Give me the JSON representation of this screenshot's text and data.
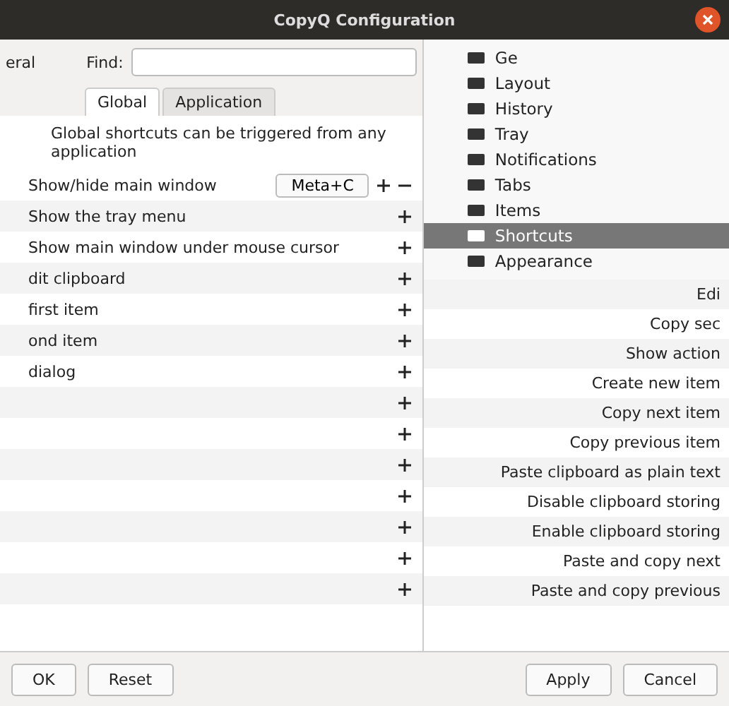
{
  "window": {
    "title": "CopyQ Configuration"
  },
  "find": {
    "label": "Find:"
  },
  "left_category": "eral",
  "tabs": [
    {
      "label": "Global",
      "selected": true
    },
    {
      "label": "Application",
      "selected": false
    }
  ],
  "info": "Global shortcuts can be triggered from any application",
  "left_rows": [
    {
      "label": "Show/hide main window",
      "shortcut": "Meta+C"
    },
    {
      "label": "Show the tray menu"
    },
    {
      "label": "Show main window under mouse cursor"
    },
    {
      "label": "dit clipboard"
    },
    {
      "label": "first item"
    },
    {
      "label": "ond item"
    },
    {
      "label": "dialog"
    },
    {},
    {},
    {},
    {},
    {},
    {},
    {}
  ],
  "categories": [
    {
      "label": "Ge",
      "selected": false
    },
    {
      "label": "Layout",
      "selected": false
    },
    {
      "label": "History",
      "selected": false
    },
    {
      "label": "Tray",
      "selected": false
    },
    {
      "label": "Notifications",
      "selected": false
    },
    {
      "label": "Tabs",
      "selected": false
    },
    {
      "label": "Items",
      "selected": false
    },
    {
      "label": "Shortcuts",
      "selected": true
    },
    {
      "label": "Appearance",
      "selected": false
    }
  ],
  "right_rows": [
    "Edi",
    "Copy sec",
    "Show action",
    "Create new item",
    "Copy next item",
    "Copy previous item",
    "Paste clipboard as plain text",
    "Disable clipboard storing",
    "Enable clipboard storing",
    "Paste and copy next",
    "Paste and copy previous"
  ],
  "buttons": {
    "left": [
      "OK",
      "Reset"
    ],
    "right": [
      "Apply",
      "Cancel"
    ]
  }
}
